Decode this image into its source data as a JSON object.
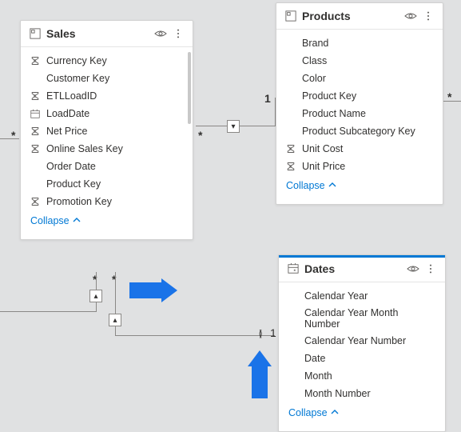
{
  "tables": {
    "sales": {
      "title": "Sales",
      "collapse_label": "Collapse",
      "fields": [
        {
          "label": "Currency Key",
          "icon": "sigma"
        },
        {
          "label": "Customer Key",
          "icon": ""
        },
        {
          "label": "ETLLoadID",
          "icon": "sigma"
        },
        {
          "label": "LoadDate",
          "icon": "calendar"
        },
        {
          "label": "Net Price",
          "icon": "sigma"
        },
        {
          "label": "Online Sales Key",
          "icon": "sigma"
        },
        {
          "label": "Order Date",
          "icon": ""
        },
        {
          "label": "Product Key",
          "icon": ""
        },
        {
          "label": "Promotion Key",
          "icon": "sigma"
        }
      ]
    },
    "products": {
      "title": "Products",
      "collapse_label": "Collapse",
      "fields": [
        {
          "label": "Brand",
          "icon": ""
        },
        {
          "label": "Class",
          "icon": ""
        },
        {
          "label": "Color",
          "icon": ""
        },
        {
          "label": "Product Key",
          "icon": ""
        },
        {
          "label": "Product Name",
          "icon": ""
        },
        {
          "label": "Product Subcategory Key",
          "icon": ""
        },
        {
          "label": "Unit Cost",
          "icon": "sigma"
        },
        {
          "label": "Unit Price",
          "icon": "sigma"
        }
      ]
    },
    "dates": {
      "title": "Dates",
      "collapse_label": "Collapse",
      "fields": [
        {
          "label": "Calendar Year",
          "icon": ""
        },
        {
          "label": "Calendar Year Month Number",
          "icon": ""
        },
        {
          "label": "Calendar Year Number",
          "icon": ""
        },
        {
          "label": "Date",
          "icon": ""
        },
        {
          "label": "Month",
          "icon": ""
        },
        {
          "label": "Month Number",
          "icon": ""
        }
      ]
    }
  },
  "connectors": {
    "sales_left_marker": "*",
    "sales_right_marker": "*",
    "products_right_marker": "*",
    "products_left_one": "1",
    "dates_left_one": "1",
    "dates_left_bracket": "()",
    "sales_bottom_marker_a": "*",
    "sales_bottom_marker_b": "*",
    "node_arrow": "▾",
    "node_arrow_up": "▴"
  },
  "annotations": {
    "arrow_right_color": "#1a73e8",
    "arrow_up_color": "#1a73e8"
  }
}
